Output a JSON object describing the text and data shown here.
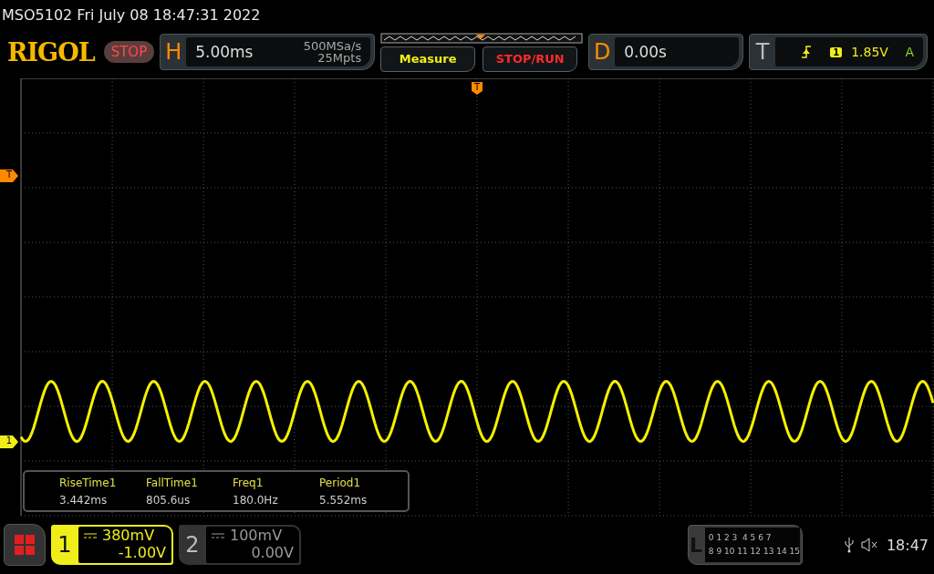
{
  "header": {
    "title": "MSO5102  Fri July 08 18:47:31 2022"
  },
  "toolbar": {
    "logo": "RIGOL",
    "run_state": "STOP",
    "horizontal": {
      "letter": "H",
      "timebase": "5.00ms",
      "sample_rate": "500MSa/s",
      "depth": "25Mpts"
    },
    "buttons": [
      {
        "label": "Measure",
        "kind": "measure"
      },
      {
        "label": "STOP/RUN",
        "kind": "run"
      }
    ],
    "delay": {
      "letter": "D",
      "value": "0.00s"
    },
    "trigger": {
      "letter": "T",
      "source": "1",
      "level": "1.85V",
      "mode": "A"
    }
  },
  "plot": {
    "trigger_marker": "T",
    "trigger_level_marker": "T",
    "channel_marker": "1"
  },
  "measurements": [
    {
      "name": "RiseTime1",
      "value": "3.442ms"
    },
    {
      "name": "FallTime1",
      "value": "805.6us"
    },
    {
      "name": "Freq1",
      "value": "180.0Hz"
    },
    {
      "name": "Period1",
      "value": "5.552ms"
    }
  ],
  "channels": [
    {
      "number": "1",
      "scale": "380mV",
      "offset": "-1.00V",
      "selected": true
    },
    {
      "number": "2",
      "scale": "100mV",
      "offset": "0.00V",
      "selected": false
    }
  ],
  "logic": {
    "letter": "L",
    "rows": [
      "0 1 2 3  4 5 6 7",
      "8 9 10 11 12 13 14 15"
    ]
  },
  "status": {
    "time": "18:47"
  }
}
